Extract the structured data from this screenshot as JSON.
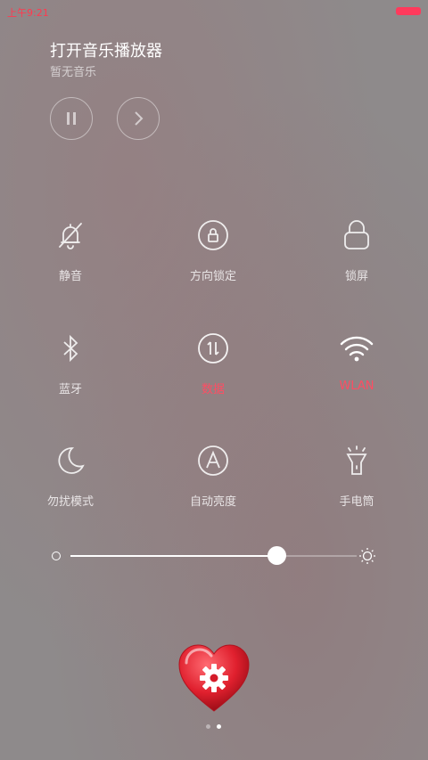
{
  "status_bar": {
    "time": "上午9:21"
  },
  "music": {
    "title": "打开音乐播放器",
    "subtitle": "暂无音乐"
  },
  "toggles": [
    {
      "label": "静音",
      "icon": "bell-off-icon",
      "active": false
    },
    {
      "label": "方向锁定",
      "icon": "rotation-lock-icon",
      "active": false
    },
    {
      "label": "锁屏",
      "icon": "lock-icon",
      "active": false
    },
    {
      "label": "蓝牙",
      "icon": "bluetooth-icon",
      "active": false
    },
    {
      "label": "数据",
      "icon": "data-transfer-icon",
      "active": true
    },
    {
      "label": "WLAN",
      "icon": "wifi-icon",
      "active": true
    },
    {
      "label": "勿扰模式",
      "icon": "moon-icon",
      "active": false
    },
    {
      "label": "自动亮度",
      "icon": "auto-brightness-icon",
      "active": false
    },
    {
      "label": "手电筒",
      "icon": "flashlight-icon",
      "active": false
    }
  ],
  "brightness": {
    "level": 0.73
  },
  "colors": {
    "accent": "#ff4d63",
    "heart": "#e0202e"
  },
  "pager": {
    "current": 2,
    "total": 2
  }
}
